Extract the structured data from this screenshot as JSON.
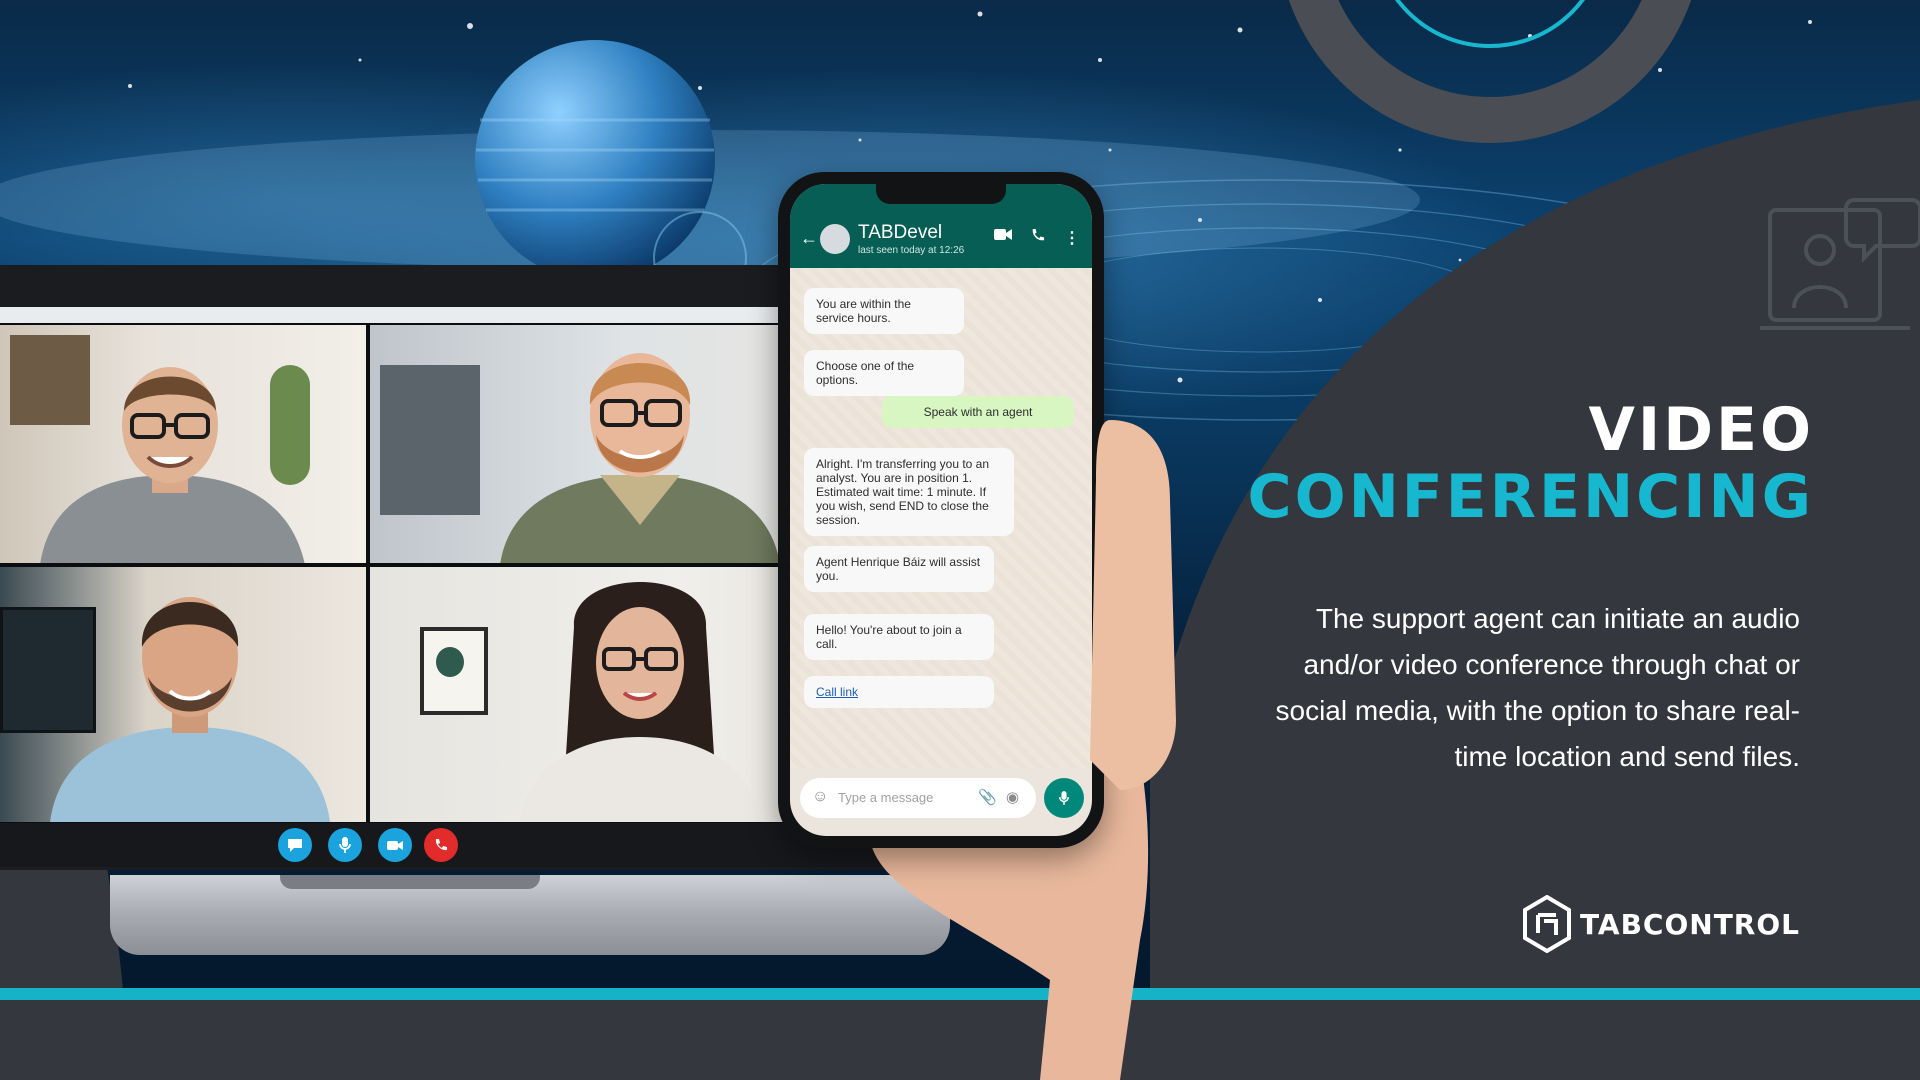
{
  "phone": {
    "contact_name": "TABDevel",
    "contact_status": "last seen today at 12:26",
    "messages": [
      {
        "side": "in",
        "text": "You are within the service hours."
      },
      {
        "side": "in",
        "text": "Choose one of the options."
      },
      {
        "side": "out",
        "text": "Speak with an agent"
      },
      {
        "side": "in",
        "text": "Alright. I'm transferring you to an analyst. You are in position 1. Estimated wait time: 1 minute. If you wish, send END to close the session."
      },
      {
        "side": "in",
        "text": "Agent Henrique Báiz will assist you."
      },
      {
        "side": "in",
        "text": "Hello! You're about to join a call."
      },
      {
        "side": "in",
        "text": "Call link"
      }
    ],
    "input_placeholder": "Type a message"
  },
  "heading": {
    "line1": "VIDEO",
    "line2": "CONFERENCING"
  },
  "description": "The support agent can initiate an audio and/or video conference through chat or social media, with the option to share real-time location and send files.",
  "logo": {
    "text": "TABCONTROL"
  },
  "colors": {
    "accent": "#17b8cf",
    "panel": "#34373d",
    "whatsapp_green": "#075e54",
    "end_call": "#e22b2b"
  },
  "icons": {
    "controls": [
      "chat-icon",
      "microphone-icon",
      "camera-icon",
      "end-call-icon"
    ]
  }
}
